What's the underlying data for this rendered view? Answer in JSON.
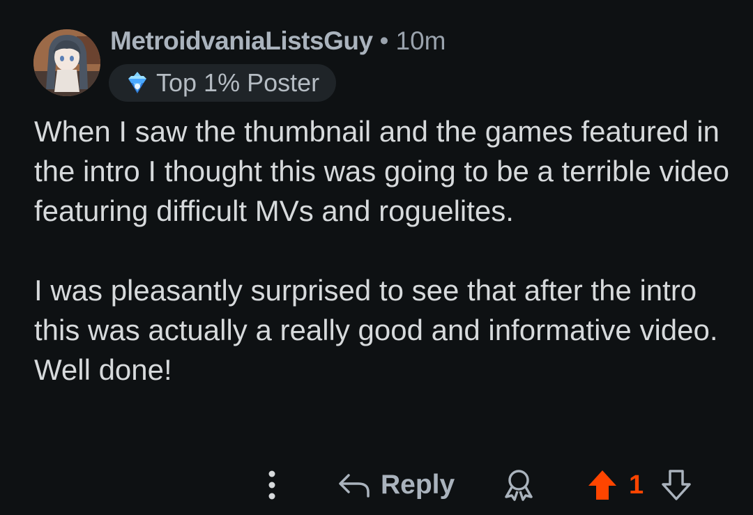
{
  "comment": {
    "author": "MetroidvaniaListsGuy",
    "separator": "•",
    "time": "10m",
    "badge_label": "Top 1% Poster",
    "paragraphs": [
      "When I saw the thumbnail and the games featured in the intro I thought this was going to be a terrible video featuring difficult MVs and roguelites.",
      "I was pleasantly surprised to see that after the intro this was actually a really good and informative video. Well done!"
    ]
  },
  "actions": {
    "reply_label": "Reply",
    "score": "1",
    "icons": [
      "more-options-icon",
      "reply-icon",
      "award-icon",
      "upvote-icon",
      "downvote-icon"
    ]
  },
  "colors": {
    "background": "#0e1113",
    "text": "#d7dadc",
    "muted": "#aab3bd",
    "upvote_active": "#ff4500",
    "badge_bg": "#1f2428"
  }
}
